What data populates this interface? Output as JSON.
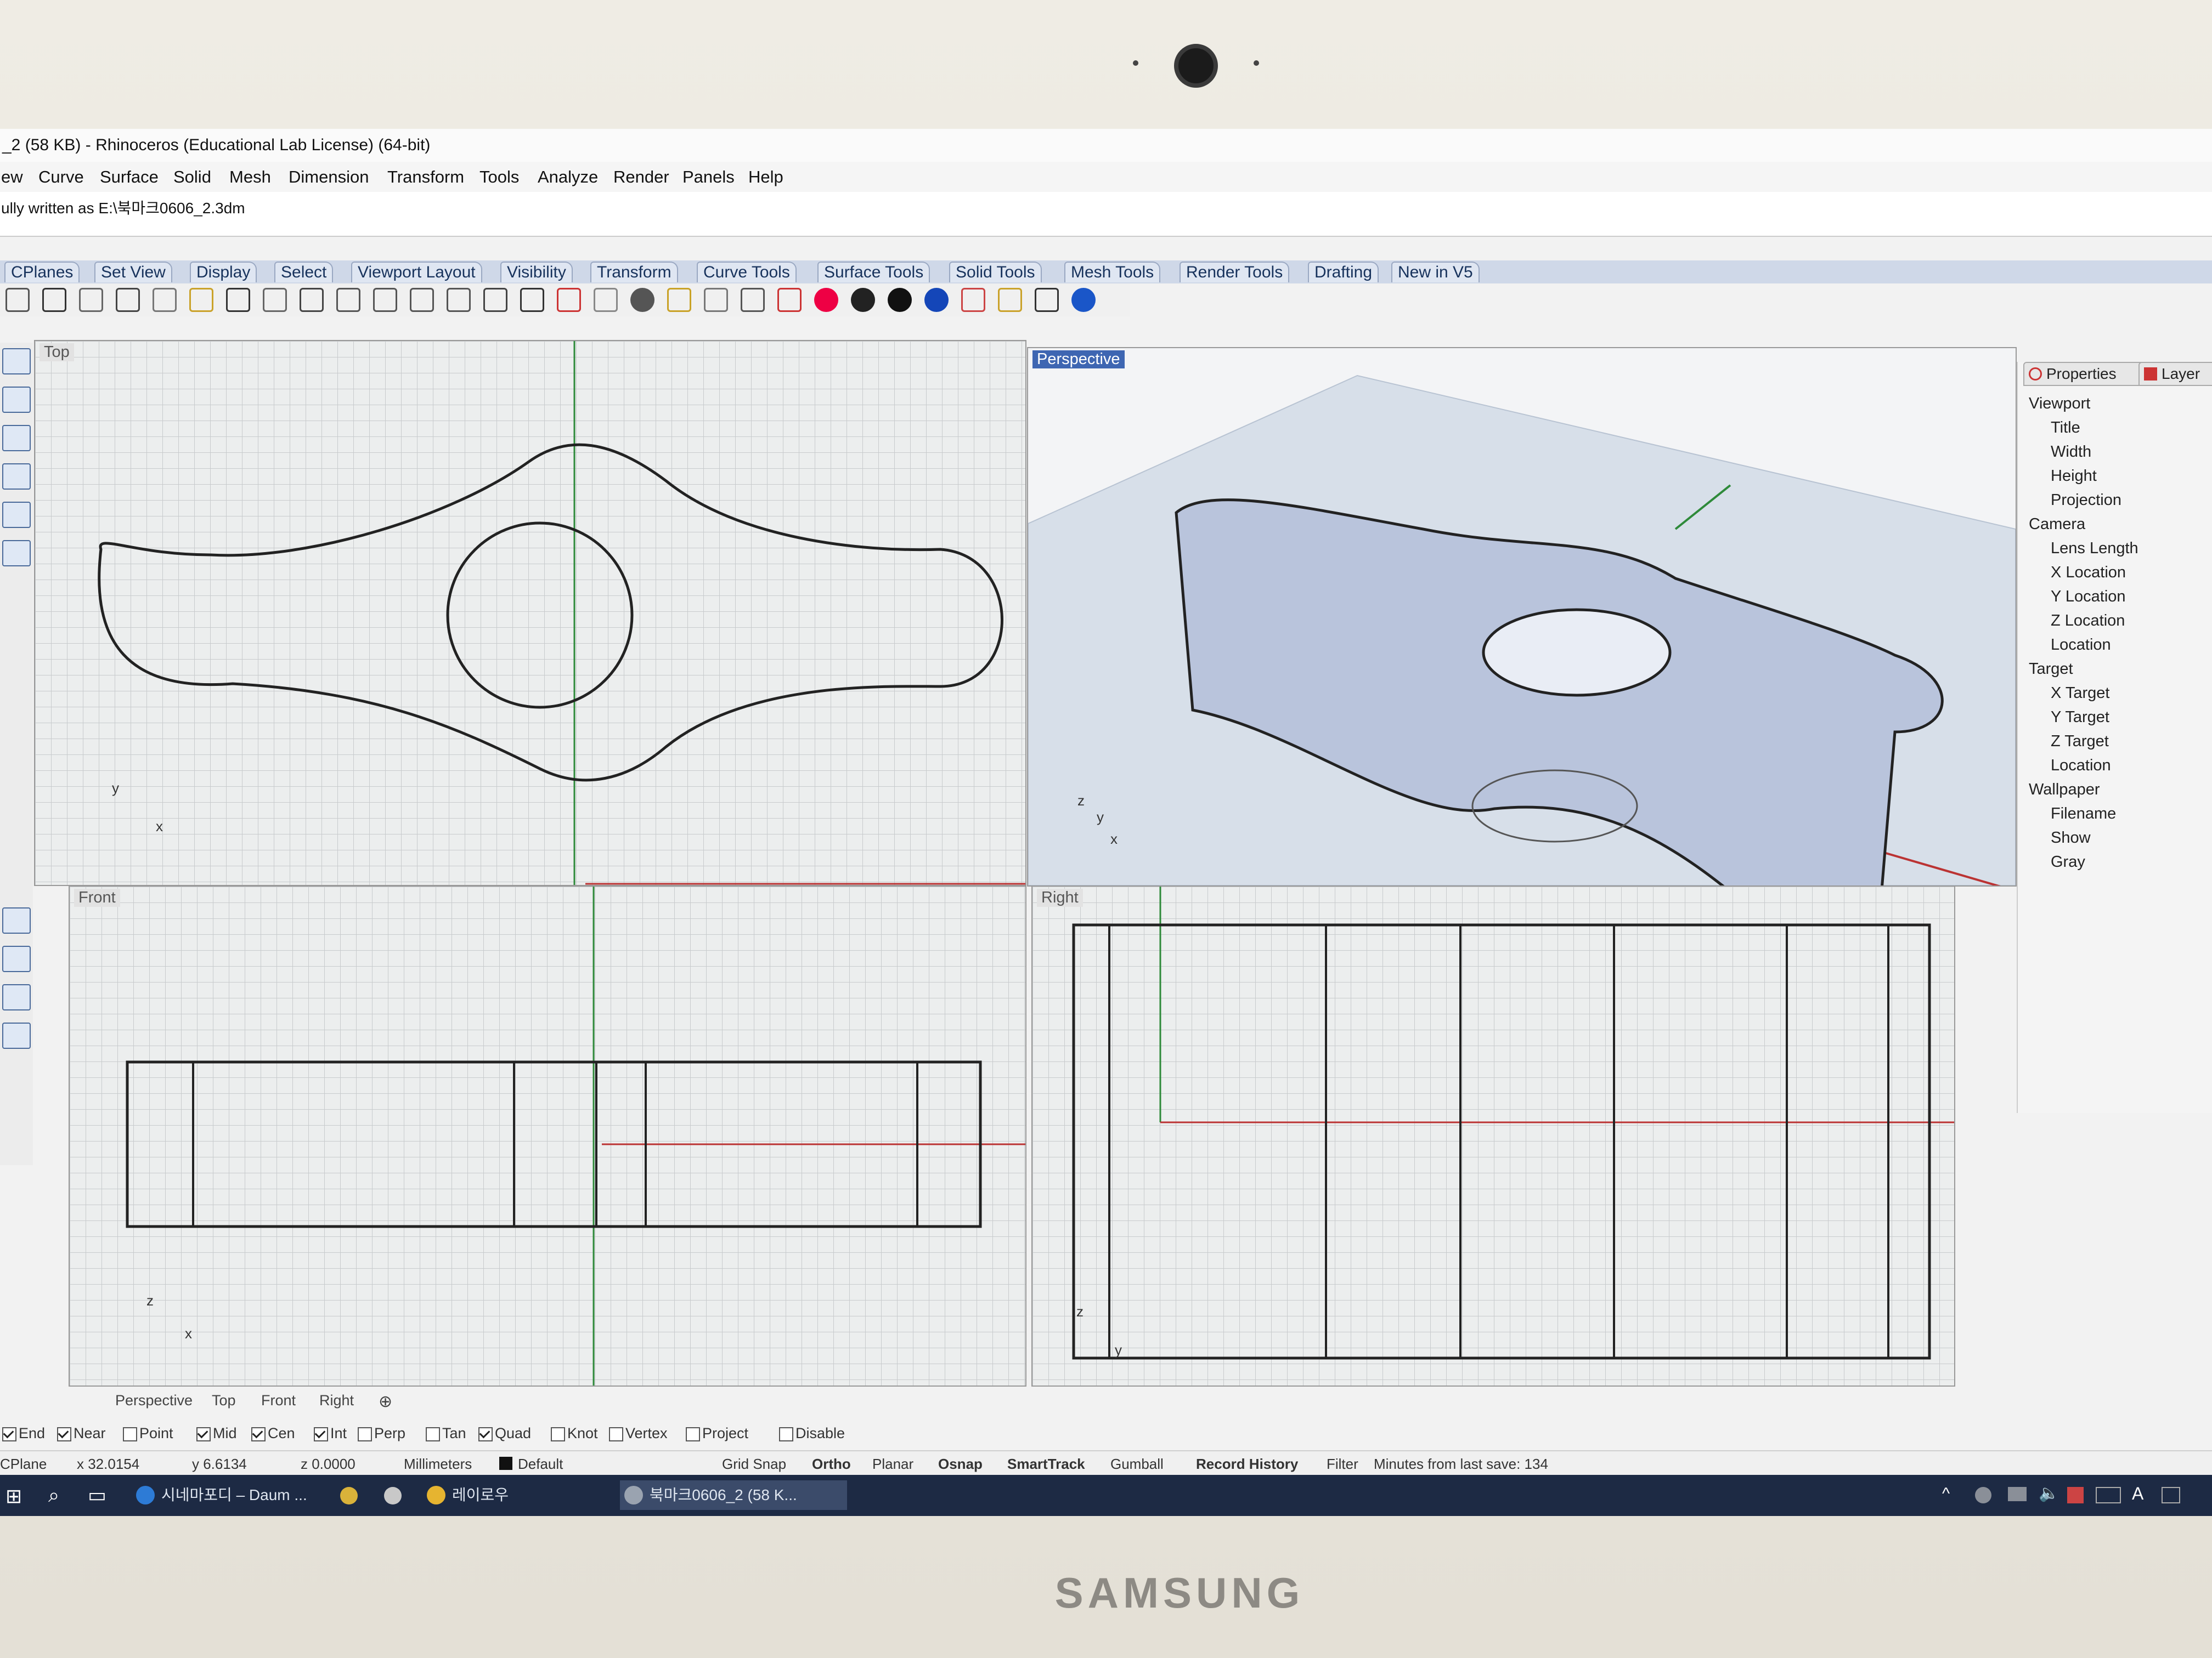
{
  "window": {
    "title": "_2 (58 KB) - Rhinoceros (Educational Lab License) (64-bit)"
  },
  "menu": [
    "ew",
    "Curve",
    "Surface",
    "Solid",
    "Mesh",
    "Dimension",
    "Transform",
    "Tools",
    "Analyze",
    "Render",
    "Panels",
    "Help"
  ],
  "command": {
    "history": "ully written as E:\\북마크0606_2.3dm"
  },
  "toolbar_tabs": [
    "CPlanes",
    "Set View",
    "Display",
    "Select",
    "Viewport Layout",
    "Visibility",
    "Transform",
    "Curve Tools",
    "Surface Tools",
    "Solid Tools",
    "Mesh Tools",
    "Render Tools",
    "Drafting",
    "New in V5"
  ],
  "toolbar_icons": [
    "new-icon",
    "print-icon",
    "open-icon",
    "cut-icon",
    "copy-icon",
    "paste-icon",
    "undo-icon",
    "pan-icon",
    "rotate-icon",
    "zoom-icon",
    "zoom-window-icon",
    "zoom-extents-icon",
    "zoom-selected-icon",
    "rotate-view-icon",
    "four-viewports-icon",
    "car-icon",
    "cplane-icon",
    "circle-icon",
    "points-icon",
    "light-icon",
    "lock-icon",
    "layers-icon",
    "color-icon",
    "shade-icon",
    "render-icon",
    "sphere-icon",
    "filter-icon",
    "settings-icon",
    "dimension-icon",
    "help-icon"
  ],
  "viewports": {
    "top": {
      "label": "Top",
      "axis_x": "x",
      "axis_y": "y"
    },
    "perspective": {
      "label": "Perspective",
      "axis_x": "x",
      "axis_y": "y",
      "axis_z": "z"
    },
    "front": {
      "label": "Front",
      "axis_x": "x",
      "axis_z": "z"
    },
    "right": {
      "label": "Right",
      "axis_y": "y",
      "axis_z": "z"
    }
  },
  "panel": {
    "tabs": [
      "Properties",
      "Layer"
    ],
    "rows": [
      {
        "label": "Viewport",
        "level": 0
      },
      {
        "label": "Title",
        "level": 1
      },
      {
        "label": "Width",
        "level": 1
      },
      {
        "label": "Height",
        "level": 1
      },
      {
        "label": "Projection",
        "level": 1
      },
      {
        "label": "Camera",
        "level": 0
      },
      {
        "label": "Lens Length",
        "level": 1
      },
      {
        "label": "X Location",
        "level": 1
      },
      {
        "label": "Y Location",
        "level": 1
      },
      {
        "label": "Z Location",
        "level": 1
      },
      {
        "label": "Location",
        "level": 1
      },
      {
        "label": "Target",
        "level": 0
      },
      {
        "label": "X Target",
        "level": 1
      },
      {
        "label": "Y Target",
        "level": 1
      },
      {
        "label": "Z Target",
        "level": 1
      },
      {
        "label": "Location",
        "level": 1
      },
      {
        "label": "Wallpaper",
        "level": 0
      },
      {
        "label": "Filename",
        "level": 1
      },
      {
        "label": "Show",
        "level": 1
      },
      {
        "label": "Gray",
        "level": 1
      }
    ]
  },
  "viewport_tabs": [
    "Perspective",
    "Top",
    "Front",
    "Right"
  ],
  "osnap": [
    {
      "label": "End",
      "checked": true
    },
    {
      "label": "Near",
      "checked": true
    },
    {
      "label": "Point",
      "checked": false
    },
    {
      "label": "Mid",
      "checked": true
    },
    {
      "label": "Cen",
      "checked": true
    },
    {
      "label": "Int",
      "checked": true
    },
    {
      "label": "Perp",
      "checked": false
    },
    {
      "label": "Tan",
      "checked": false
    },
    {
      "label": "Quad",
      "checked": true
    },
    {
      "label": "Knot",
      "checked": false
    },
    {
      "label": "Vertex",
      "checked": false
    },
    {
      "label": "Project",
      "checked": false
    },
    {
      "label": "Disable",
      "checked": false
    }
  ],
  "status": {
    "cplane": "CPlane",
    "x": "x 32.0154",
    "y": "y 6.6134",
    "z": "z 0.0000",
    "units": "Millimeters",
    "layer": "Default",
    "grid_snap": "Grid Snap",
    "ortho": "Ortho",
    "planar": "Planar",
    "osnap": "Osnap",
    "smarttrack": "SmartTrack",
    "gumball": "Gumball",
    "record_history": "Record History",
    "filter": "Filter",
    "minutes": "Minutes from last save: 134"
  },
  "taskbar": {
    "items": [
      "시네마포디 – Daum ...",
      "레이로우",
      "북마크0606_2 (58 K..."
    ]
  },
  "bezel": {
    "brand": "SAMSUNG"
  }
}
